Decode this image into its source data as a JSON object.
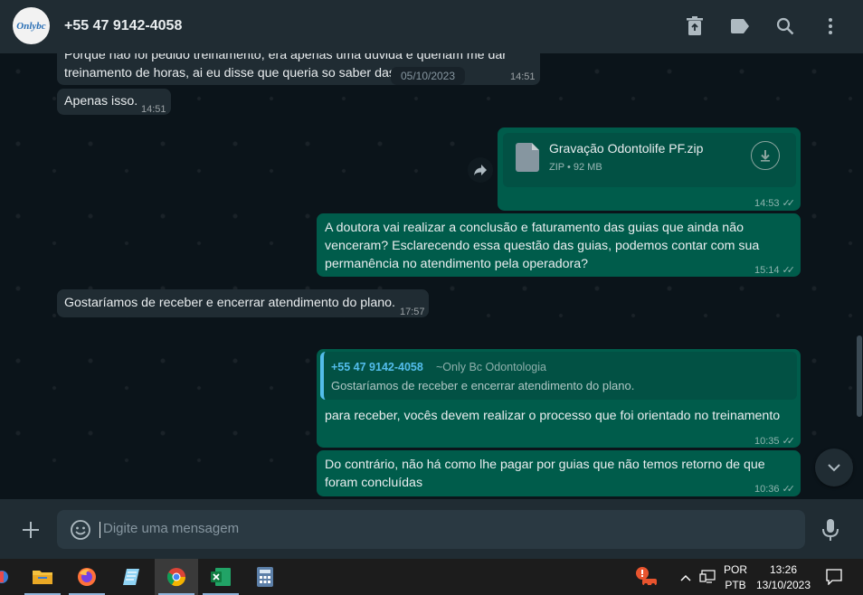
{
  "header": {
    "avatar_text": "Onlybc",
    "contact_name": "+55 47 9142-4058",
    "icons": [
      "delete-icon",
      "label-icon",
      "search-icon",
      "menu-icon"
    ]
  },
  "messages": {
    "m1_line1": "Porque não foi pedido treinamento, era apenas uma dúvida e queriam me dar",
    "m1_line2": "treinamento de horas, ai eu disse que queria so saber das",
    "m1_time": "14:51",
    "date_chip": "05/10/2023",
    "m2_text": "Apenas isso.",
    "m2_time": "14:51",
    "file_name": "Gravação Odontolife PF.zip",
    "file_meta": "ZIP • 92 MB",
    "m3_time": "14:53",
    "m4_line1": "A doutora vai realizar a conclusão e faturamento das guias que ainda não",
    "m4_line2": "venceram? Esclarecendo essa questão das guias, podemos contar com sua",
    "m4_line3": "permanência no atendimento pela operadora?",
    "m4_time": "15:14",
    "m5_text": "Gostaríamos de receber e encerrar atendimento do plano.",
    "m5_time": "17:57",
    "quote_author": "+55 47 9142-4058",
    "quote_alias": "~Only Bc Odontologia",
    "quote_text": "Gostaríamos de receber e encerrar atendimento do plano.",
    "m6_text": "para receber, vocês devem realizar o processo que foi orientado no treinamento",
    "m6_time": "10:35",
    "m7_line1": "Do contrário, não há como lhe pagar por guias que não temos retorno de que",
    "m7_line2": "foram concluídas",
    "m7_time": "10:36"
  },
  "composer": {
    "placeholder": "Digite uma mensagem"
  },
  "taskbar": {
    "lang_top": "POR",
    "lang_bottom": "PTB",
    "time": "13:26",
    "date": "13/10/2023"
  },
  "colors": {
    "incoming": "#202c33",
    "outgoing": "#005c4b",
    "accent": "#53bdeb"
  }
}
